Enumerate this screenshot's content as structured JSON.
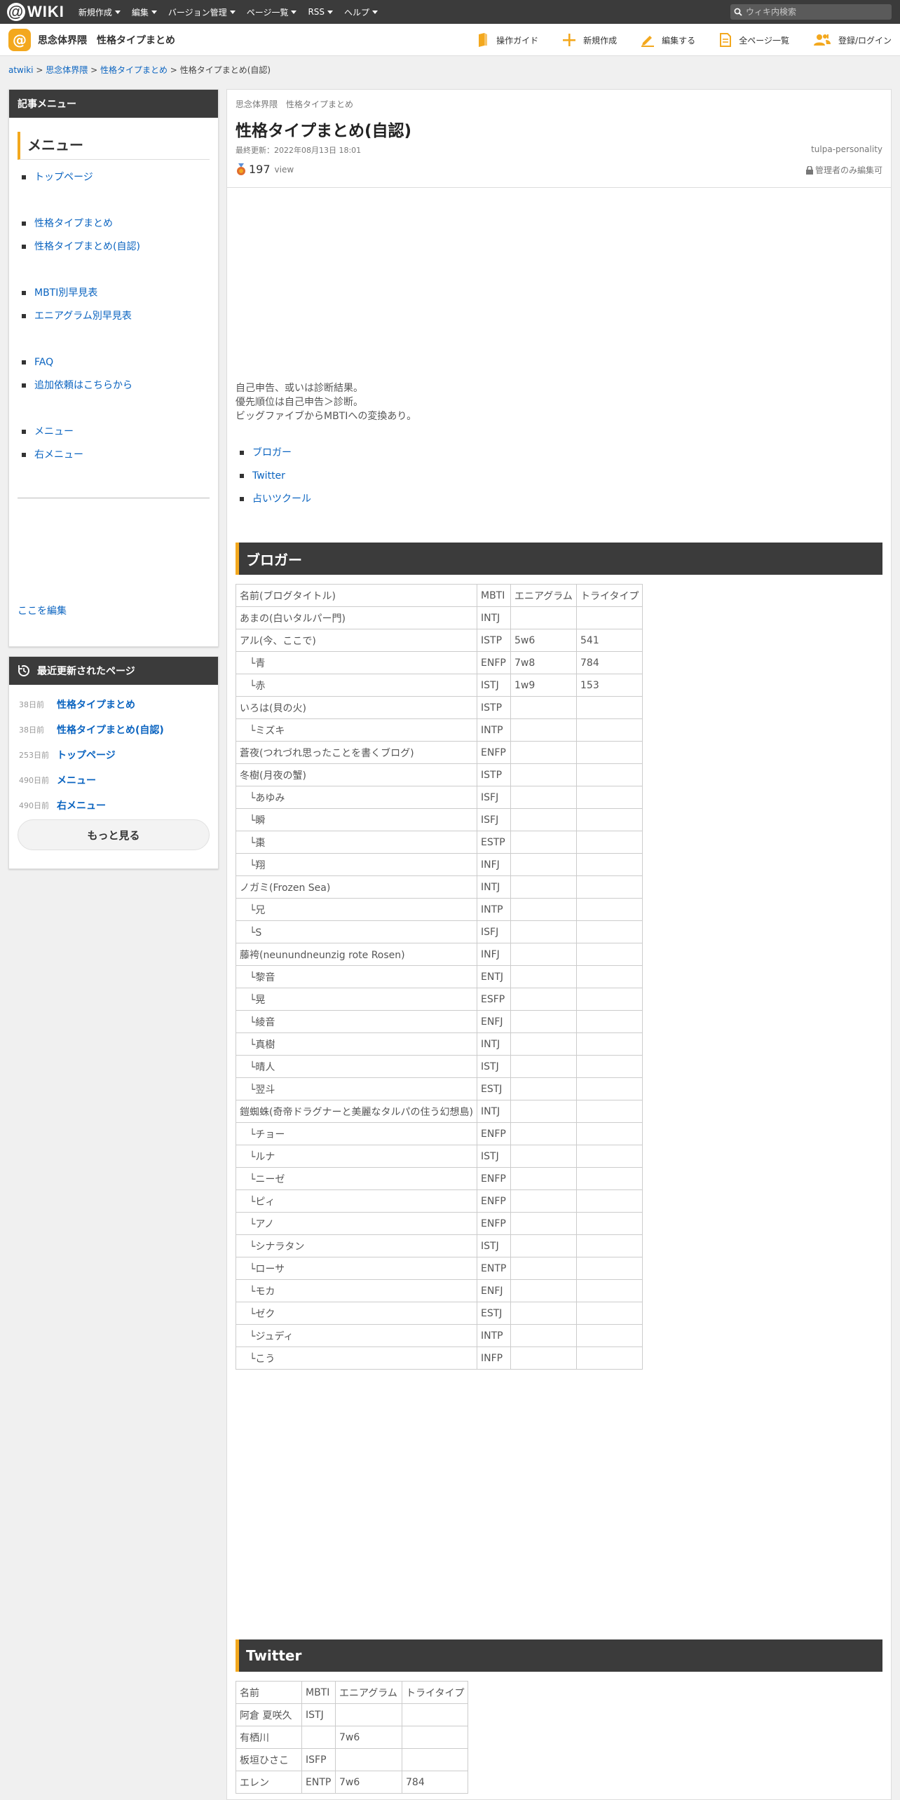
{
  "topbar": {
    "logo_text": "WIKI",
    "nav": [
      "新規作成",
      "編集",
      "バージョン管理",
      "ページ一覧",
      "RSS",
      "ヘルプ"
    ],
    "search_placeholder": "ウィキ内検索"
  },
  "site": {
    "name": "思念体界隈",
    "page": "性格タイプまとめ",
    "tools": [
      "操作ガイド",
      "新規作成",
      "編集する",
      "全ページ一覧",
      "登録/ログイン"
    ]
  },
  "breadcrumb": {
    "root": "atwiki",
    "sep": ">",
    "site": "思念体界隈",
    "parent": "性格タイプまとめ",
    "current": "性格タイプまとめ(自認)"
  },
  "sidebar": {
    "menu_box_title": "記事メニュー",
    "menu_heading": "メニュー",
    "menu_items": [
      "トップページ",
      "",
      "性格タイプまとめ",
      "性格タイプまとめ(自認)",
      "",
      "MBTI別早見表",
      "エニアグラム別早見表",
      "",
      "FAQ",
      "追加依頼はこちらから",
      "",
      "メニュー",
      "右メニュー"
    ],
    "edit_link": "ここを編集",
    "recent_title": "最近更新されたページ",
    "recent": [
      {
        "ago": "38日前",
        "title": "性格タイプまとめ"
      },
      {
        "ago": "38日前",
        "title": "性格タイプまとめ(自認)"
      },
      {
        "ago": "253日前",
        "title": "トップページ"
      },
      {
        "ago": "490日前",
        "title": "メニュー"
      },
      {
        "ago": "490日前",
        "title": "右メニュー"
      }
    ],
    "more_label": "もっと見る"
  },
  "main": {
    "crumb": "思念体界隈　性格タイプまとめ",
    "title": "性格タイプまとめ(自認)",
    "updated": "最終更新：2022年08月13日 18:01",
    "tag": "tulpa-personality",
    "views": "197",
    "views_unit": "view",
    "lock_text": "管理者のみ編集可",
    "intro": [
      "自己申告、或いは診断結果。",
      "優先順位は自己申告＞診断。",
      "ビッグファイブからMBTIへの変換あり。"
    ],
    "jump_links": [
      "ブロガー",
      "Twitter",
      "占いツクール"
    ],
    "section1": "ブロガー",
    "section2": "Twitter"
  },
  "table1": {
    "headers": [
      "名前(ブログタイトル)",
      "MBTI",
      "エニアグラム",
      "トライタイプ"
    ],
    "rows": [
      [
        "あまの(白いタルパー門)",
        "INTJ",
        "",
        ""
      ],
      [
        "アル(今、ここで)",
        "ISTP",
        "5w6",
        "541"
      ],
      [
        "　└青",
        "ENFP",
        "7w8",
        "784"
      ],
      [
        "　└赤",
        "ISTJ",
        "1w9",
        "153"
      ],
      [
        "いろは(貝の火)",
        "ISTP",
        "",
        ""
      ],
      [
        "　└ミズキ",
        "INTP",
        "",
        ""
      ],
      [
        "蒼夜(つれづれ思ったことを書くブログ)",
        "ENFP",
        "",
        ""
      ],
      [
        "冬樹(月夜の蟹)",
        "ISTP",
        "",
        ""
      ],
      [
        "　└あゆみ",
        "ISFJ",
        "",
        ""
      ],
      [
        "　└瞬",
        "ISFJ",
        "",
        ""
      ],
      [
        "　└棗",
        "ESTP",
        "",
        ""
      ],
      [
        "　└翔",
        "INFJ",
        "",
        ""
      ],
      [
        "ノガミ(Frozen Sea)",
        "INTJ",
        "",
        ""
      ],
      [
        "　└兄",
        "INTP",
        "",
        ""
      ],
      [
        "　└S",
        "ISFJ",
        "",
        ""
      ],
      [
        "藤袴(neunundneunzig rote Rosen)",
        "INFJ",
        "",
        ""
      ],
      [
        "　└黎音",
        "ENTJ",
        "",
        ""
      ],
      [
        "　└晃",
        "ESFP",
        "",
        ""
      ],
      [
        "　└綾音",
        "ENFJ",
        "",
        ""
      ],
      [
        "　└真樹",
        "INTJ",
        "",
        ""
      ],
      [
        "　└晴人",
        "ISTJ",
        "",
        ""
      ],
      [
        "　└翌斗",
        "ESTJ",
        "",
        ""
      ],
      [
        "鎧蜘蛛(奇帝ドラグナーと美麗なタルパの住う幻想島)",
        "INTJ",
        "",
        ""
      ],
      [
        "　└チョー",
        "ENFP",
        "",
        ""
      ],
      [
        "　└ルナ",
        "ISTJ",
        "",
        ""
      ],
      [
        "　└ニーゼ",
        "ENFP",
        "",
        ""
      ],
      [
        "　└ピィ",
        "ENFP",
        "",
        ""
      ],
      [
        "　└アノ",
        "ENFP",
        "",
        ""
      ],
      [
        "　└シナラタン",
        "ISTJ",
        "",
        ""
      ],
      [
        "　└ローサ",
        "ENTP",
        "",
        ""
      ],
      [
        "　└モカ",
        "ENFJ",
        "",
        ""
      ],
      [
        "　└ゼク",
        "ESTJ",
        "",
        ""
      ],
      [
        "　└ジュディ",
        "INTP",
        "",
        ""
      ],
      [
        "　└こう",
        "INFP",
        "",
        ""
      ]
    ]
  },
  "table2": {
    "headers": [
      "名前",
      "MBTI",
      "エニアグラム",
      "トライタイプ"
    ],
    "rows": [
      [
        "阿倉 夏咲久",
        "ISTJ",
        "",
        ""
      ],
      [
        "有栖川",
        "",
        "7w6",
        ""
      ],
      [
        "板垣ひさこ",
        "ISFP",
        "",
        ""
      ],
      [
        "エレン",
        "ENTP",
        "7w6",
        "784"
      ]
    ]
  }
}
